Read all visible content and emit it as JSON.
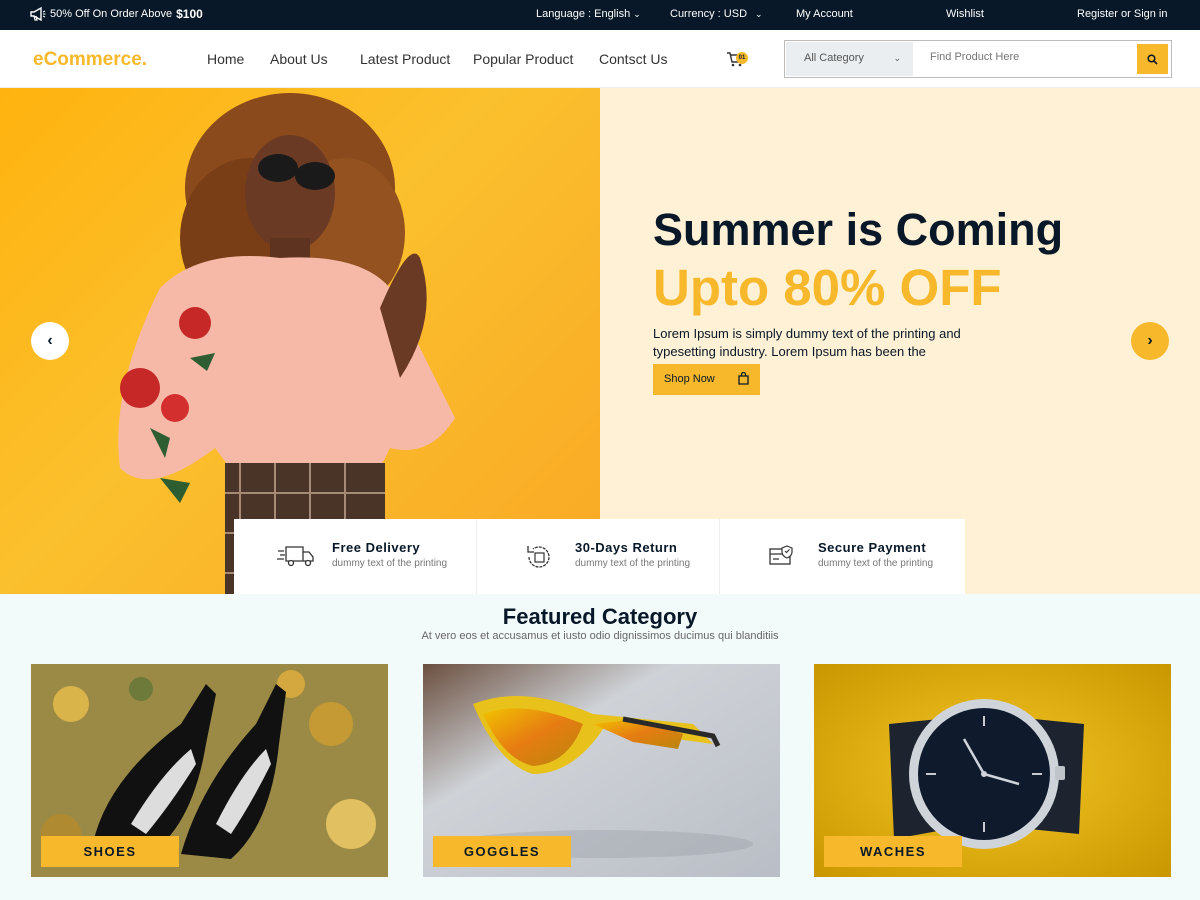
{
  "topbar": {
    "promo_prefix": "50% Off On Order Above",
    "promo_amount": "$100",
    "language": "Language : English",
    "currency": "Currency : USD",
    "account": "My Account",
    "wishlist": "Wishlist",
    "register": "Register or Sign in"
  },
  "header": {
    "logo": "eCommerce.",
    "nav": [
      "Home",
      "About Us",
      "Latest Product",
      "Popular Product",
      "Contsct Us"
    ],
    "cart_count": "01",
    "category": "All Category",
    "search_placeholder": "Find Product Here"
  },
  "hero": {
    "title": "Summer is Coming",
    "subtitle": "Upto 80% OFF",
    "description": "Lorem Ipsum is simply dummy text of the printing and typesetting industry. Lorem Ipsum has been the",
    "button": "Shop Now"
  },
  "features": [
    {
      "title": "Free Delivery",
      "desc": "dummy text of the printing",
      "icon": "truck-icon"
    },
    {
      "title": "30-Days Return",
      "desc": "dummy text of the printing",
      "icon": "return-icon"
    },
    {
      "title": "Secure Payment",
      "desc": "dummy text of the printing",
      "icon": "secure-payment-icon"
    }
  ],
  "featured": {
    "title": "Featured Category",
    "subtitle": "At vero eos et accusamus et iusto odio dignissimos ducimus qui blanditiis",
    "cards": [
      {
        "label": "SHOES"
      },
      {
        "label": "GOGGLES"
      },
      {
        "label": "WACHES"
      }
    ]
  },
  "colors": {
    "accent": "#f7b92b",
    "dark": "#081828",
    "hero_bg": "#fef1d5"
  }
}
